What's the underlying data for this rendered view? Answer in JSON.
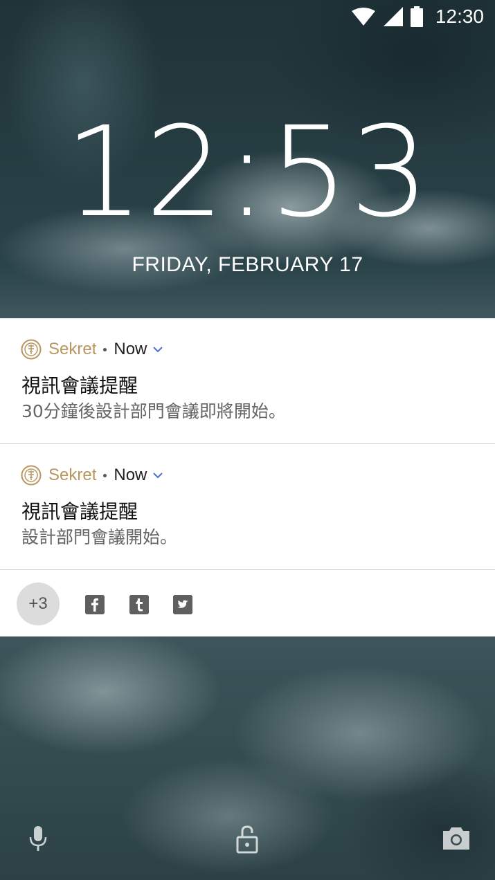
{
  "status_bar": {
    "time": "12:30",
    "icons": [
      "wifi-icon",
      "cell-signal-icon",
      "battery-icon"
    ]
  },
  "lockscreen": {
    "clock": "12:53",
    "date": "FRIDAY, FEBRUARY 17"
  },
  "notifications": [
    {
      "app_name": "Sekret",
      "time": "Now",
      "title": "視訊會議提醒",
      "body": "30分鐘後設計部門會議即將開始。"
    },
    {
      "app_name": "Sekret",
      "time": "Now",
      "title": "視訊會議提醒",
      "body": "設計部門會議開始。"
    }
  ],
  "shelf": {
    "overflow_count": "+3",
    "app_icons": [
      "facebook-icon",
      "tumblr-icon",
      "twitter-icon"
    ]
  },
  "bottom_actions": [
    "microphone-icon",
    "unlock-icon",
    "camera-icon"
  ],
  "colors": {
    "app_name": "#b8965e",
    "chevron": "#4a6fd1"
  }
}
